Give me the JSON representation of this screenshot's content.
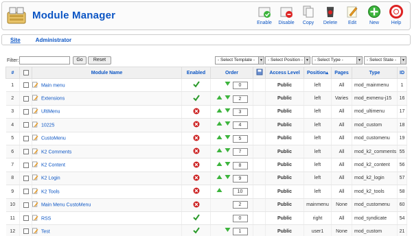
{
  "header": {
    "title": "Module Manager"
  },
  "toolbar": [
    {
      "label": "Enable",
      "icon": "enable-icon"
    },
    {
      "label": "Disable",
      "icon": "disable-icon"
    },
    {
      "label": "Copy",
      "icon": "copy-icon"
    },
    {
      "label": "Delete",
      "icon": "delete-icon"
    },
    {
      "label": "Edit",
      "icon": "edit-icon"
    },
    {
      "label": "New",
      "icon": "new-icon"
    },
    {
      "label": "Help",
      "icon": "help-icon"
    }
  ],
  "submenu": {
    "site": "Site",
    "administrator": "Administrator"
  },
  "filter": {
    "label": "Filter:",
    "value": "",
    "go_label": "Go",
    "reset_label": "Reset",
    "template": "- Select Template -",
    "position": "- Select Position -",
    "type": "- Select Type -",
    "state": "- Select State -"
  },
  "columns": {
    "num": "#",
    "name": "Module Name",
    "enabled": "Enabled",
    "order": "Order",
    "access": "Access Level",
    "position": "Position▴",
    "pages": "Pages",
    "type": "Type",
    "id": "ID"
  },
  "rows": [
    {
      "num": "1",
      "name": "Main menu",
      "enabled": true,
      "order": "0",
      "up": false,
      "down": true,
      "access": "Public",
      "position": "left",
      "pages": "All",
      "type": "mod_mainmenu",
      "id": "1"
    },
    {
      "num": "2",
      "name": "Extensions",
      "enabled": true,
      "order": "2",
      "up": true,
      "down": true,
      "access": "Public",
      "position": "left",
      "pages": "Varies",
      "type": "mod_exmenu-j15",
      "id": "16"
    },
    {
      "num": "3",
      "name": "UltiMenu",
      "enabled": false,
      "order": "3",
      "up": true,
      "down": true,
      "access": "Public",
      "position": "left",
      "pages": "All",
      "type": "mod_ultimenu",
      "id": "17"
    },
    {
      "num": "4",
      "name": "10225",
      "enabled": false,
      "order": "4",
      "up": true,
      "down": true,
      "access": "Public",
      "position": "left",
      "pages": "All",
      "type": "mod_custom",
      "id": "18"
    },
    {
      "num": "5",
      "name": "CustoMenu",
      "enabled": false,
      "order": "5",
      "up": true,
      "down": true,
      "access": "Public",
      "position": "left",
      "pages": "All",
      "type": "mod_customenu",
      "id": "19"
    },
    {
      "num": "6",
      "name": "K2 Comments",
      "enabled": false,
      "order": "7",
      "up": true,
      "down": true,
      "access": "Public",
      "position": "left",
      "pages": "All",
      "type": "mod_k2_comments",
      "id": "55"
    },
    {
      "num": "7",
      "name": "K2 Content",
      "enabled": false,
      "order": "8",
      "up": true,
      "down": true,
      "access": "Public",
      "position": "left",
      "pages": "All",
      "type": "mod_k2_content",
      "id": "56"
    },
    {
      "num": "8",
      "name": "K2 Login",
      "enabled": false,
      "order": "9",
      "up": true,
      "down": true,
      "access": "Public",
      "position": "left",
      "pages": "All",
      "type": "mod_k2_login",
      "id": "57"
    },
    {
      "num": "9",
      "name": "K2 Tools",
      "enabled": false,
      "order": "10",
      "up": true,
      "down": false,
      "access": "Public",
      "position": "left",
      "pages": "All",
      "type": "mod_k2_tools",
      "id": "58"
    },
    {
      "num": "10",
      "name": "Main Menu CustoMenu",
      "enabled": false,
      "order": "2",
      "up": false,
      "down": false,
      "access": "Public",
      "position": "mainmenu",
      "pages": "None",
      "type": "mod_customenu",
      "id": "60"
    },
    {
      "num": "11",
      "name": "RSS",
      "enabled": true,
      "order": "0",
      "up": false,
      "down": false,
      "access": "Public",
      "position": "right",
      "pages": "All",
      "type": "mod_syndicate",
      "id": "54"
    },
    {
      "num": "12",
      "name": "Test",
      "enabled": true,
      "order": "1",
      "up": false,
      "down": true,
      "access": "Public",
      "position": "user1",
      "pages": "None",
      "type": "mod_custom",
      "id": "21"
    }
  ],
  "colors": {
    "link": "#0b55c4",
    "publish": "#0a8a0a",
    "enabled": "#2a9a2a",
    "disabled": "#cc2222"
  }
}
